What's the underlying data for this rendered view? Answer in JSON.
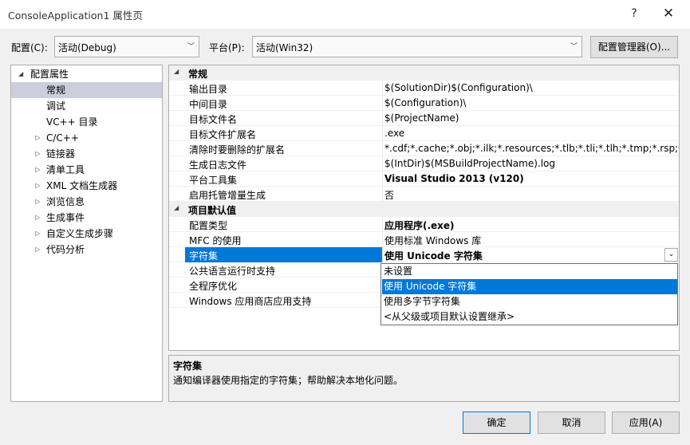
{
  "window": {
    "title": "ConsoleApplication1 属性页",
    "help": "?",
    "close": "✕"
  },
  "toolbar": {
    "config_label": "配置(C):",
    "config_value": "活动(Debug)",
    "platform_label": "平台(P):",
    "platform_value": "活动(Win32)",
    "manager_button": "配置管理器(O)..."
  },
  "tree": {
    "root": "配置属性",
    "items": [
      {
        "label": "常规",
        "expander": false,
        "selected": true
      },
      {
        "label": "调试",
        "expander": false
      },
      {
        "label": "VC++ 目录",
        "expander": false
      },
      {
        "label": "C/C++",
        "expander": true
      },
      {
        "label": "链接器",
        "expander": true
      },
      {
        "label": "清单工具",
        "expander": true
      },
      {
        "label": "XML 文档生成器",
        "expander": true
      },
      {
        "label": "浏览信息",
        "expander": true
      },
      {
        "label": "生成事件",
        "expander": true
      },
      {
        "label": "自定义生成步骤",
        "expander": true
      },
      {
        "label": "代码分析",
        "expander": true
      }
    ]
  },
  "grid": {
    "cat_general": "常规",
    "cat_defaults": "项目默认值",
    "general_rows": [
      {
        "name": "输出目录",
        "value": "$(SolutionDir)$(Configuration)\\"
      },
      {
        "name": "中间目录",
        "value": "$(Configuration)\\"
      },
      {
        "name": "目标文件名",
        "value": "$(ProjectName)"
      },
      {
        "name": "目标文件扩展名",
        "value": ".exe"
      },
      {
        "name": "清除时要删除的扩展名",
        "value": "*.cdf;*.cache;*.obj;*.ilk;*.resources;*.tlb;*.tli;*.tlh;*.tmp;*.rsp;*.pgc;*"
      },
      {
        "name": "生成日志文件",
        "value": "$(IntDir)$(MSBuildProjectName).log"
      },
      {
        "name": "平台工具集",
        "value": "Visual Studio 2013 (v120)",
        "bold": true
      },
      {
        "name": "启用托管增量生成",
        "value": "否"
      }
    ],
    "default_rows": [
      {
        "name": "配置类型",
        "value": "应用程序(.exe)",
        "bold": true
      },
      {
        "name": "MFC 的使用",
        "value": "使用标准 Windows 库"
      },
      {
        "name": "字符集",
        "value": "使用 Unicode 字符集",
        "selected": true
      },
      {
        "name": "公共语言运行时支持",
        "value": ""
      },
      {
        "name": "全程序优化",
        "value": ""
      },
      {
        "name": "Windows 应用商店应用支持",
        "value": ""
      }
    ]
  },
  "dropdown": {
    "options": [
      "未设置",
      "使用 Unicode 字符集",
      "使用多字节字符集",
      "<从父级或项目默认设置继承>"
    ],
    "highlighted_index": 1
  },
  "description": {
    "title": "字符集",
    "text": "通知编译器使用指定的字符集；帮助解决本地化问题。"
  },
  "buttons": {
    "ok": "确定",
    "cancel": "取消",
    "apply": "应用(A)"
  },
  "colors": {
    "selection": "#0078d7",
    "tree_selection": "#cccedb"
  }
}
